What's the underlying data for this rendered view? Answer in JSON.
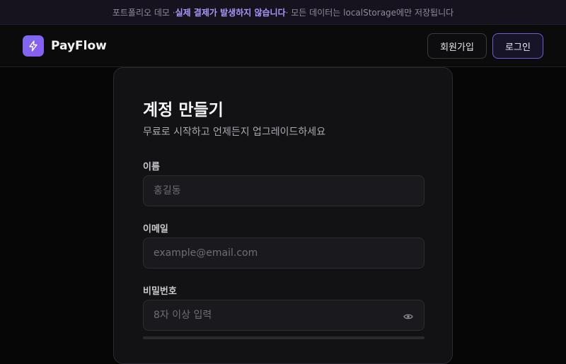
{
  "banner": {
    "prefix": "포트폴리오 데모 · ",
    "highlight": "실제 결제가 발생하지 않습니다",
    "suffix": " · 모든 데이터는 localStorage에만 저장됩니다"
  },
  "header": {
    "logo_icon": "lightning-bolt-icon",
    "brand": "PayFlow",
    "signup_label": "회원가입",
    "login_label": "로그인"
  },
  "form": {
    "title": "계정 만들기",
    "subtitle": "무료로 시작하고 언제든지 업그레이드하세요",
    "name": {
      "label": "이름",
      "placeholder": "홍길동",
      "value": ""
    },
    "email": {
      "label": "이메일",
      "placeholder": "example@email.com",
      "value": ""
    },
    "password": {
      "label": "비밀번호",
      "placeholder": "8자 이상 입력",
      "value": "",
      "toggle_icon": "eye-icon",
      "strength_fraction": 0
    }
  },
  "colors": {
    "accent": "#8b5cf6",
    "banner_highlight": "#a996f7",
    "background": "#060606",
    "card": "#121214"
  }
}
